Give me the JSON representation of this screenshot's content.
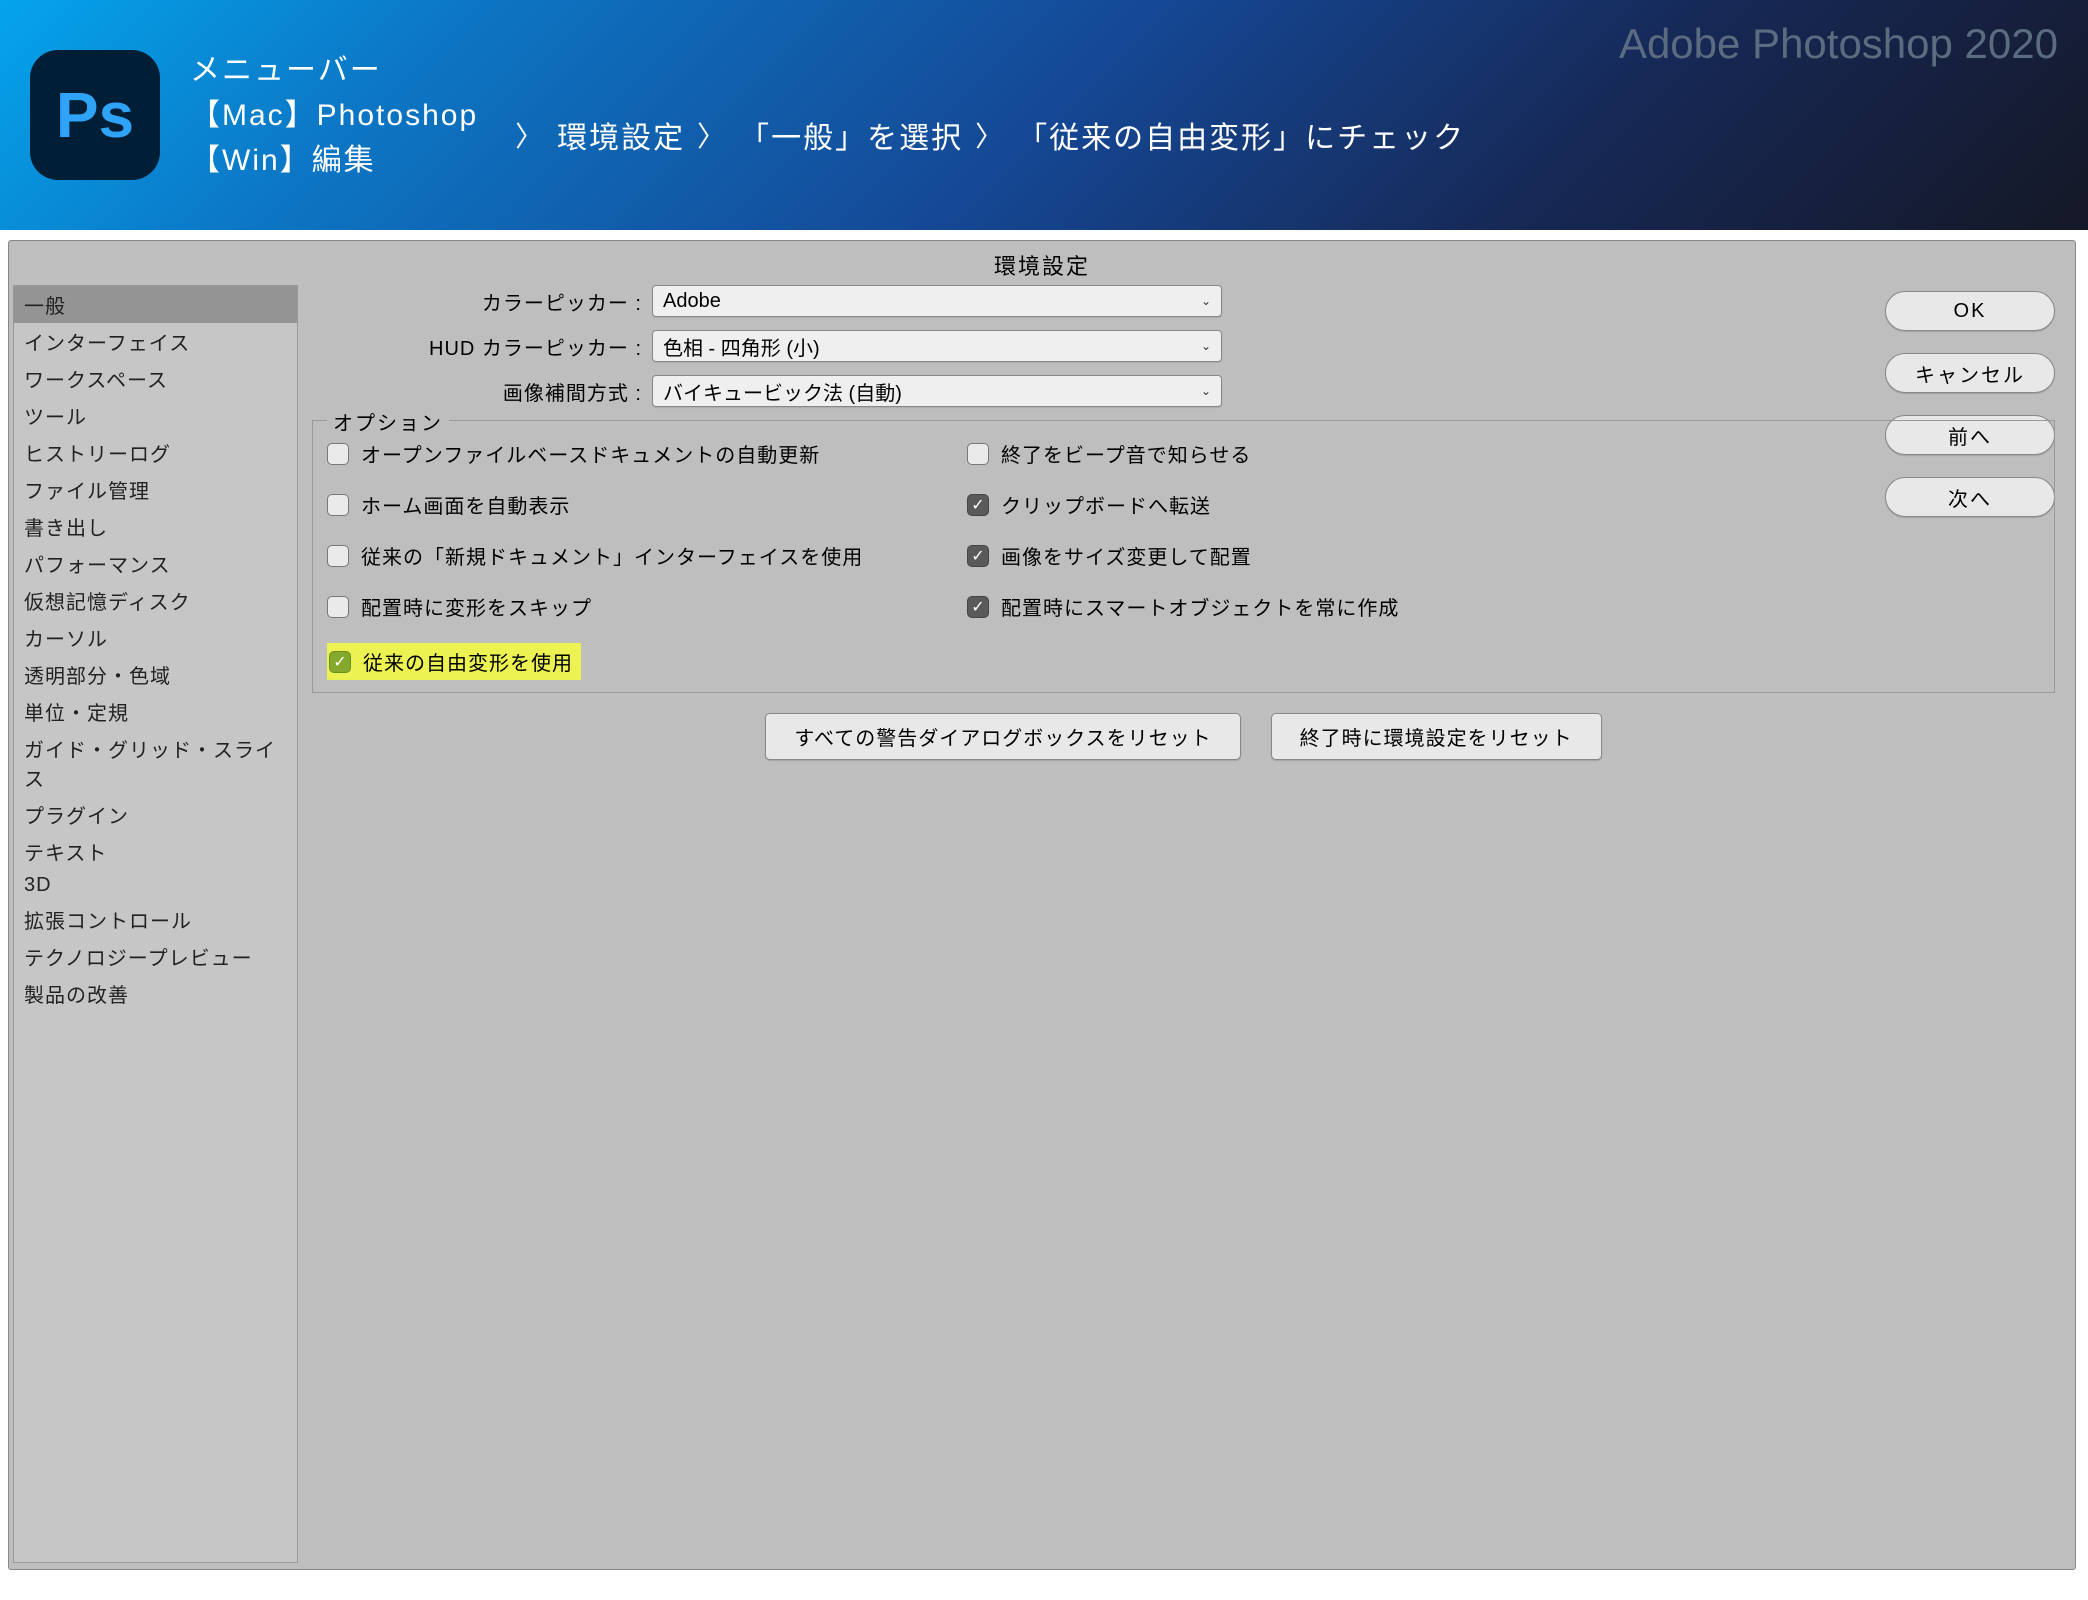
{
  "banner": {
    "app_logo_text": "Ps",
    "line1": "メニューバー",
    "line2": "【Mac】Photoshop",
    "line3": "【Win】編集",
    "crumb1": "環境設定",
    "crumb2": "「一般」を選択",
    "crumb3": "「従来の自由変形」にチェック",
    "year_label": "Adobe Photoshop 2020"
  },
  "dialog": {
    "title": "環境設定",
    "sidebar": [
      "一般",
      "インターフェイス",
      "ワークスペース",
      "ツール",
      "ヒストリーログ",
      "ファイル管理",
      "書き出し",
      "パフォーマンス",
      "仮想記憶ディスク",
      "カーソル",
      "透明部分・色域",
      "単位・定規",
      "ガイド・グリッド・スライス",
      "プラグイン",
      "テキスト",
      "3D",
      "拡張コントロール",
      "テクノロジープレビュー",
      "製品の改善"
    ],
    "rows": {
      "color_picker_label": "カラーピッカー :",
      "color_picker_value": "Adobe",
      "hud_label": "HUD カラーピッカー :",
      "hud_value": "色相 - 四角形 (小)",
      "interp_label": "画像補間方式 :",
      "interp_value": "バイキュービック法 (自動)"
    },
    "options_legend": "オプション",
    "opts_left": [
      {
        "label": "オープンファイルベースドキュメントの自動更新",
        "checked": false
      },
      {
        "label": "ホーム画面を自動表示",
        "checked": false
      },
      {
        "label": "従来の「新規ドキュメント」インターフェイスを使用",
        "checked": false
      },
      {
        "label": "配置時に変形をスキップ",
        "checked": false
      },
      {
        "label": "従来の自由変形を使用",
        "checked": true,
        "highlight": true
      }
    ],
    "opts_right": [
      {
        "label": "終了をビープ音で知らせる",
        "checked": false
      },
      {
        "label": "クリップボードへ転送",
        "checked": true
      },
      {
        "label": "画像をサイズ変更して配置",
        "checked": true
      },
      {
        "label": "配置時にスマートオブジェクトを常に作成",
        "checked": true
      }
    ],
    "bottom_buttons": {
      "reset_warnings": "すべての警告ダイアログボックスをリセット",
      "reset_on_quit": "終了時に環境設定をリセット"
    },
    "right_buttons": {
      "ok": "OK",
      "cancel": "キャンセル",
      "prev": "前へ",
      "next": "次へ"
    }
  }
}
